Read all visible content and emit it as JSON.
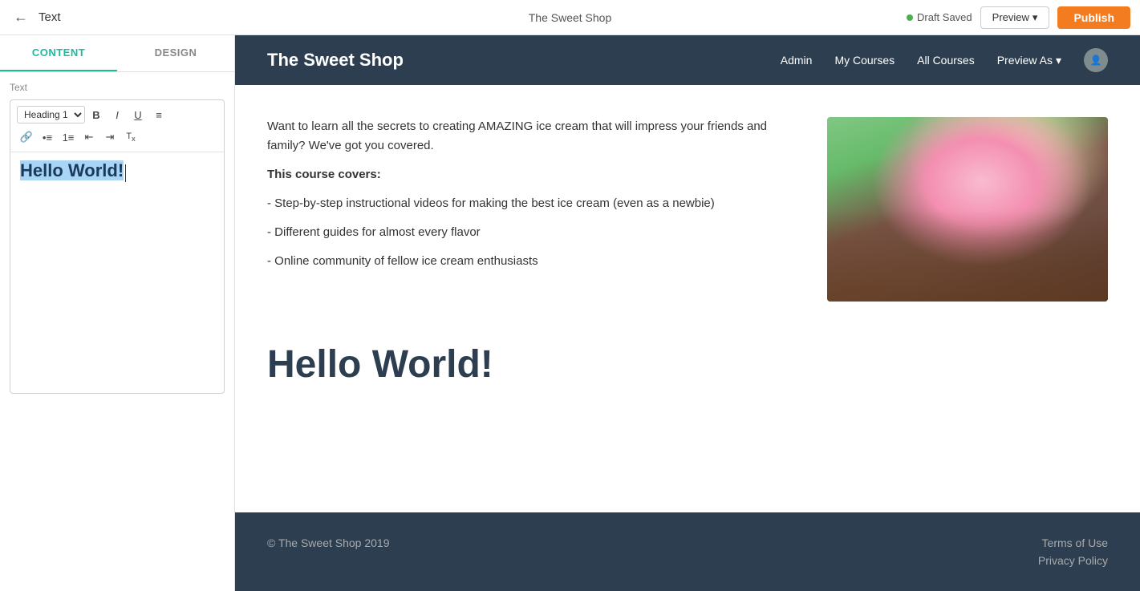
{
  "topbar": {
    "back_icon": "←",
    "page_title": "Text",
    "site_name": "The Sweet Shop",
    "draft_saved_label": "Draft Saved",
    "preview_label": "Preview",
    "preview_arrow": "▾",
    "publish_label": "Publish"
  },
  "left_panel": {
    "tab_content": "CONTENT",
    "tab_design": "DESIGN",
    "section_label": "Text",
    "heading_label": "Heading",
    "heading_select": "Heading 1",
    "editor_text": "Hello World!",
    "toolbar": {
      "bold": "B",
      "italic": "I",
      "underline": "U",
      "align": "≡",
      "link": "🔗",
      "unordered_list": "•≡",
      "ordered_list": "1≡",
      "indent_less": "⇤",
      "indent_more": "⇥",
      "clear_format": "Tx"
    }
  },
  "site_nav": {
    "title": "The Sweet Shop",
    "links": [
      "Admin",
      "My Courses",
      "All Courses"
    ],
    "preview_as": "Preview As",
    "preview_arrow": "▾"
  },
  "page_content": {
    "intro_p1": "Want to learn all the secrets to creating AMAZING ice cream that will impress your friends and family? We've got you covered.",
    "course_covers_label": "This course covers:",
    "bullet1": "- Step-by-step instructional videos for making the best ice cream (even as a newbie)",
    "bullet2": "- Different guides for almost every flavor",
    "bullet3": "- Online community of fellow ice cream enthusiasts",
    "heading": "Hello World!"
  },
  "footer": {
    "copyright": "© The Sweet Shop 2019",
    "link1": "Terms of Use",
    "link2": "Privacy Policy"
  }
}
